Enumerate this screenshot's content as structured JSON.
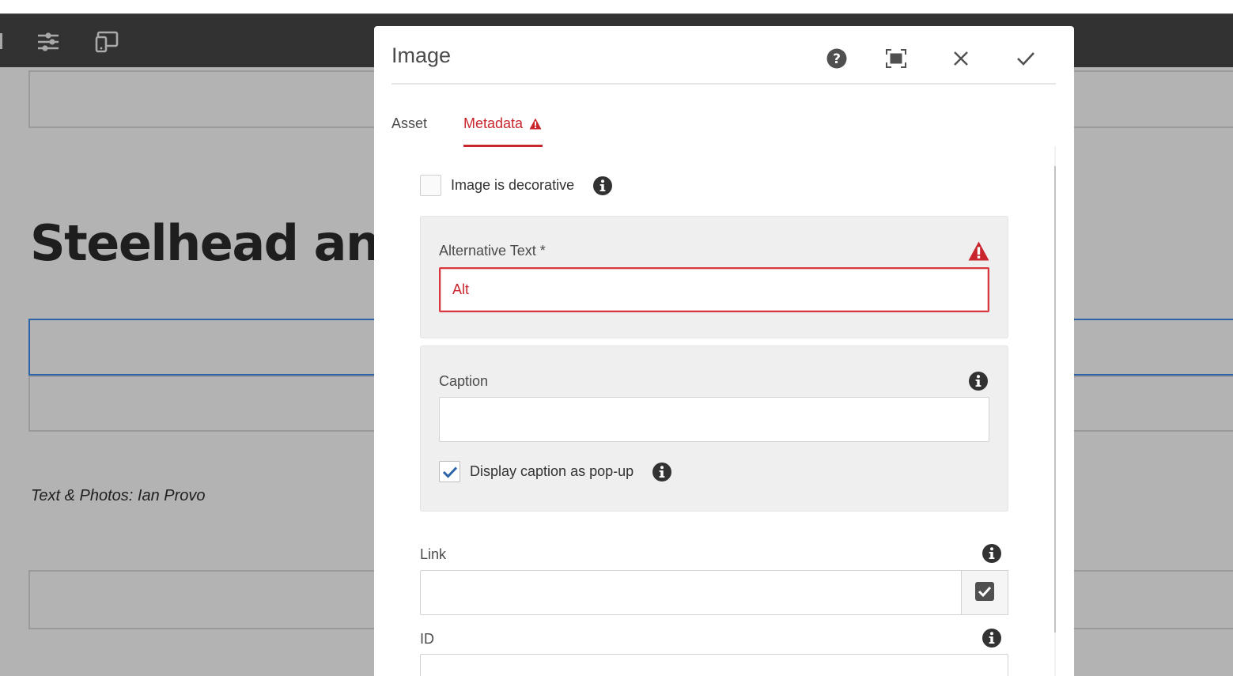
{
  "toolbar": {
    "icons": [
      "sliders-icon",
      "device-preview-icon"
    ]
  },
  "page": {
    "heading": "Steelhead an",
    "credit": "Text & Photos: Ian Provo"
  },
  "dialog": {
    "title": "Image",
    "actions": [
      "help-icon",
      "fullscreen-icon",
      "close-icon",
      "done-checkmark-icon"
    ],
    "tabs": [
      {
        "label": "Asset",
        "active": false
      },
      {
        "label": "Metadata",
        "active": true,
        "has_error": true
      }
    ],
    "decorative": {
      "label": "Image is decorative",
      "checked": false
    },
    "alt_text": {
      "label": "Alternative Text *",
      "value": "Alt",
      "error": true
    },
    "caption": {
      "label": "Caption",
      "value": ""
    },
    "caption_popup": {
      "label": "Display caption as pop-up",
      "checked": true
    },
    "link": {
      "label": "Link",
      "value": ""
    },
    "id_field": {
      "label": "ID",
      "value": ""
    }
  },
  "colors": {
    "error": "#c9252d",
    "accent_blue": "#2d63a7",
    "toolbar_bg": "#323232",
    "overlay_bg": "#b3b3b3"
  }
}
